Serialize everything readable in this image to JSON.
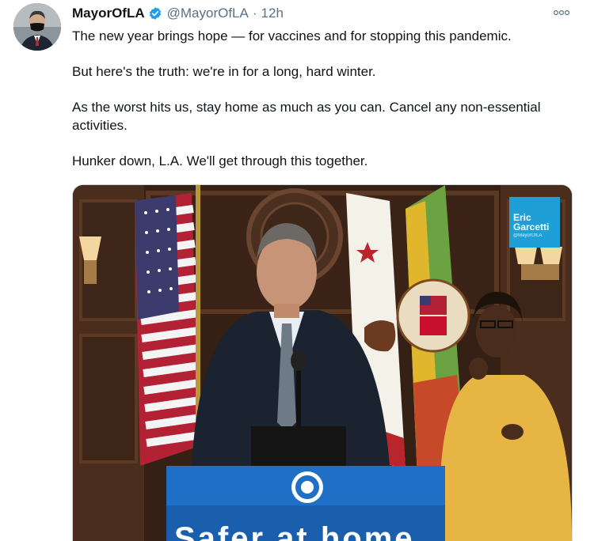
{
  "tweet": {
    "display_name": "MayorOfLA",
    "handle": "@MayorOfLA",
    "separator": "·",
    "time": "12h",
    "paragraphs": [
      "The new year brings hope — for vaccines and for stopping this pandemic.",
      "But here's the truth: we're in for a long, hard winter.",
      "As the worst hits us, stay home as much as you can. Cancel any non-essential activities.",
      "Hunker down, L.A. We'll get through this together."
    ]
  },
  "media": {
    "logo_line1": "Eric",
    "logo_line2": "Garcetti",
    "logo_line3": "@MayorOfLA",
    "podium_text": "Safer at home"
  },
  "colors": {
    "verified_blue": "#1d9bf0",
    "podium_blue": "#1f6fc6",
    "logo_blue": "#1e9fd6"
  },
  "icons": [
    "verified-badge-icon",
    "more-options-icon"
  ]
}
